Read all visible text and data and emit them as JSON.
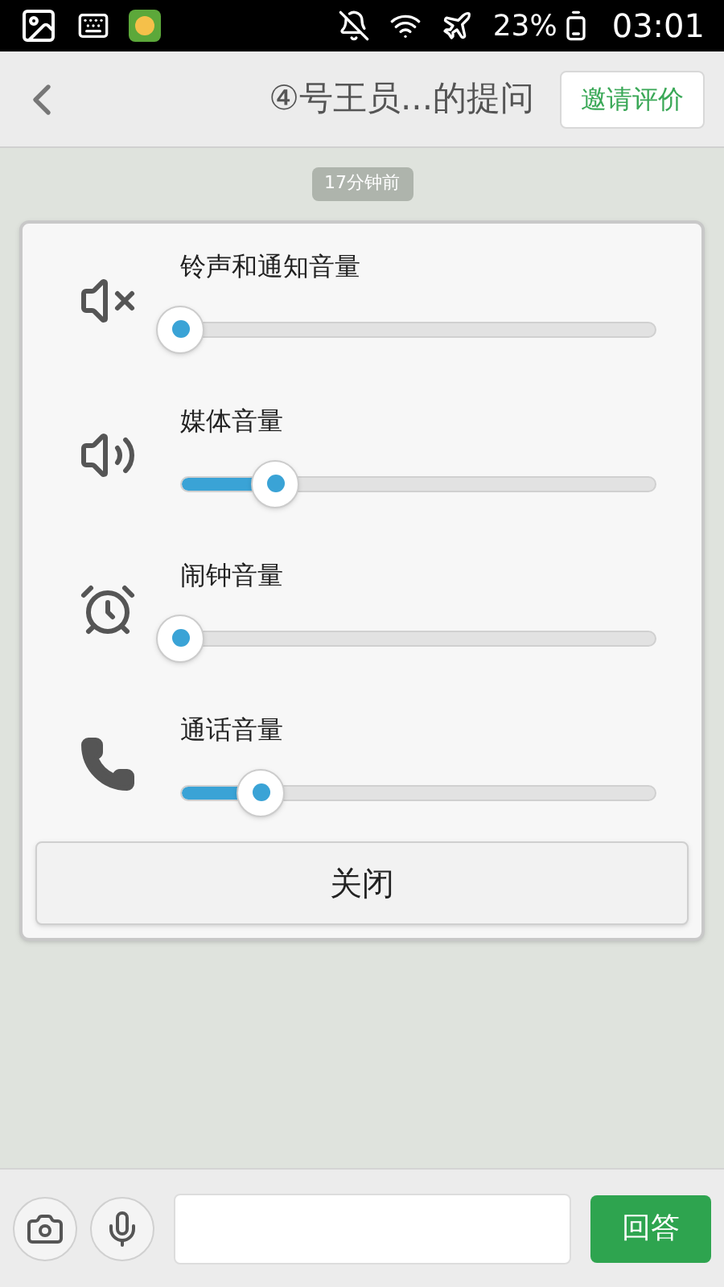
{
  "status_bar": {
    "battery": "23%",
    "time": "03:01"
  },
  "header": {
    "title": "④号王员...的提问",
    "action": "邀请评价"
  },
  "chat": {
    "timestamp": "17分钟前"
  },
  "volume_dialog": {
    "rows": [
      {
        "kind": "ringer_muted",
        "label": "铃声和通知音量"
      },
      {
        "kind": "media",
        "label": "媒体音量",
        "level": 0.2
      },
      {
        "kind": "alarm",
        "label": "闹钟音量"
      },
      {
        "kind": "call",
        "label": "通话音量",
        "level": 0.17
      }
    ],
    "close": "关闭"
  },
  "composer": {
    "send": "回答"
  }
}
